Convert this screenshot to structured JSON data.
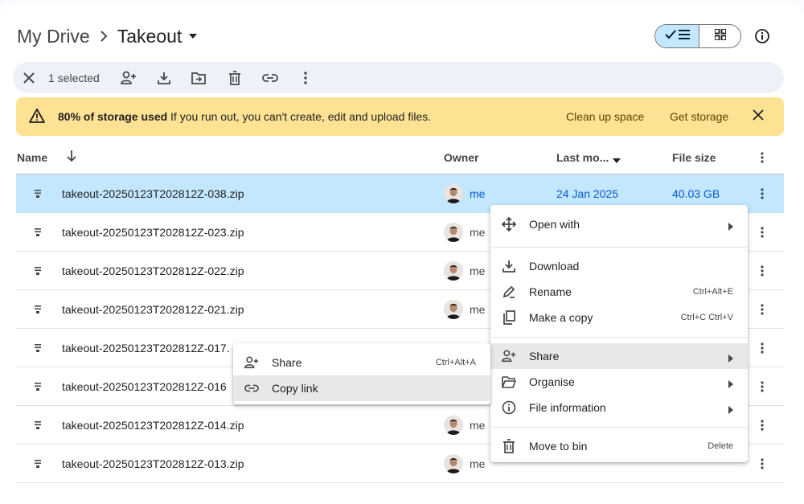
{
  "breadcrumb": {
    "root": "My Drive",
    "current": "Takeout"
  },
  "selection": {
    "count_label": "1 selected"
  },
  "banner": {
    "bold": "80% of storage used",
    "text": " If you run out, you can't create, edit and upload files.",
    "clean_up": "Clean up space",
    "get_storage": "Get storage"
  },
  "columns": {
    "name": "Name",
    "owner": "Owner",
    "modified": "Last mo...",
    "size": "File size"
  },
  "files": [
    {
      "name": "takeout-20250123T202812Z-038.zip",
      "owner": "me",
      "modified": "24 Jan 2025",
      "size": "40.03 GB",
      "selected": true
    },
    {
      "name": "takeout-20250123T202812Z-023.zip",
      "owner": "me",
      "modified": "",
      "size": ""
    },
    {
      "name": "takeout-20250123T202812Z-022.zip",
      "owner": "me",
      "modified": "",
      "size": ""
    },
    {
      "name": "takeout-20250123T202812Z-021.zip",
      "owner": "me",
      "modified": "",
      "size": ""
    },
    {
      "name": "takeout-20250123T202812Z-017.",
      "owner": "",
      "modified": "",
      "size": ""
    },
    {
      "name": "takeout-20250123T202812Z-016",
      "owner": "",
      "modified": "",
      "size": ""
    },
    {
      "name": "takeout-20250123T202812Z-014.zip",
      "owner": "me",
      "modified": "",
      "size": ""
    },
    {
      "name": "takeout-20250123T202812Z-013.zip",
      "owner": "me",
      "modified": "",
      "size": ""
    }
  ],
  "context_menu": {
    "open_with": "Open with",
    "download": "Download",
    "rename": "Rename",
    "rename_shortcut": "Ctrl+Alt+E",
    "make_copy": "Make a copy",
    "make_copy_shortcut": "Ctrl+C Ctrl+V",
    "share": "Share",
    "organise": "Organise",
    "file_information": "File information",
    "move_to_bin": "Move to bin",
    "move_to_bin_shortcut": "Delete"
  },
  "share_submenu": {
    "share": "Share",
    "share_shortcut": "Ctrl+Alt+A",
    "copy_link": "Copy link"
  },
  "colors": {
    "selected_row": "#c2e7ff",
    "accent": "#0b57d0",
    "banner": "#fde293"
  }
}
